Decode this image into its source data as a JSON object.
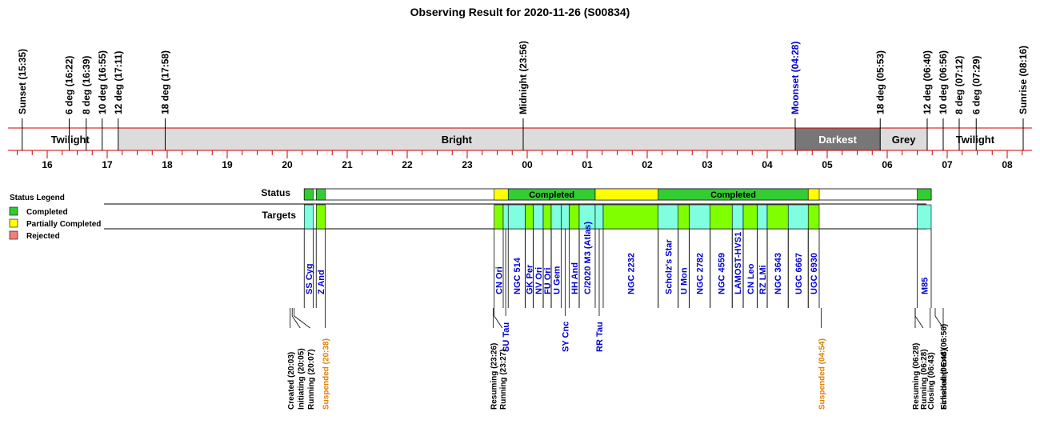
{
  "title": "Observing Result for 2020-11-26 (S00834)",
  "colors": {
    "axis": "#cc0000",
    "bright": "#dcdcdc",
    "darkest": "#777777",
    "grey": "#dcdcdc",
    "completed": "#33cc33",
    "partial": "#ffff00",
    "rejected": "#f08080",
    "target_green": "#80ff00",
    "target_cyan": "#80ffe0",
    "target_text": "#0000cc",
    "event_text": "#000000",
    "suspended": "#e08000"
  },
  "time_ticks": [
    {
      "time": "16:00",
      "label": "16"
    },
    {
      "time": "17:00",
      "label": "17"
    },
    {
      "time": "18:00",
      "label": "18"
    },
    {
      "time": "19:00",
      "label": "19"
    },
    {
      "time": "20:00",
      "label": "20"
    },
    {
      "time": "21:00",
      "label": "21"
    },
    {
      "time": "22:00",
      "label": "22"
    },
    {
      "time": "23:00",
      "label": "23"
    },
    {
      "time": "24:00",
      "label": "00"
    },
    {
      "time": "25:00",
      "label": "01"
    },
    {
      "time": "26:00",
      "label": "02"
    },
    {
      "time": "27:00",
      "label": "03"
    },
    {
      "time": "28:00",
      "label": "04"
    },
    {
      "time": "29:00",
      "label": "05"
    },
    {
      "time": "30:00",
      "label": "06"
    },
    {
      "time": "31:00",
      "label": "07"
    },
    {
      "time": "32:00",
      "label": "08"
    }
  ],
  "sky_events": [
    {
      "label": "Sunset (15:35)",
      "time": "15:35",
      "color": "#000000"
    },
    {
      "label": "6 deg (16:22)",
      "time": "16:22",
      "color": "#000000"
    },
    {
      "label": "8 deg (16:39)",
      "time": "16:39",
      "color": "#000000"
    },
    {
      "label": "10 deg (16:55)",
      "time": "16:55",
      "color": "#000000"
    },
    {
      "label": "12 deg (17:11)",
      "time": "17:11",
      "color": "#000000"
    },
    {
      "label": "18 deg (17:58)",
      "time": "17:58",
      "color": "#000000"
    },
    {
      "label": "Midnight (23:56)",
      "time": "23:56",
      "color": "#000000"
    },
    {
      "label": "Moonset (04:28)",
      "time": "28:28",
      "color": "#0000cc"
    },
    {
      "label": "18 deg (05:53)",
      "time": "29:53",
      "color": "#000000"
    },
    {
      "label": "12 deg (06:40)",
      "time": "30:40",
      "color": "#000000"
    },
    {
      "label": "10 deg (06:56)",
      "time": "30:56",
      "color": "#000000"
    },
    {
      "label": "8 deg (07:12)",
      "time": "31:12",
      "color": "#000000"
    },
    {
      "label": "6 deg (07:29)",
      "time": "31:29",
      "color": "#000000"
    },
    {
      "label": "Sunrise (08:16)",
      "time": "32:16",
      "color": "#000000"
    }
  ],
  "sky_bands": [
    {
      "label": "Twilight",
      "start": "15:35",
      "end": "17:11",
      "fill": "#ffffff",
      "text": "#000000"
    },
    {
      "label": "Bright",
      "start": "17:11",
      "end": "28:28",
      "fill": "#dcdcdc",
      "text": "#000000"
    },
    {
      "label": "Darkest",
      "start": "28:28",
      "end": "29:53",
      "fill": "#777777",
      "text": "#ffffff"
    },
    {
      "label": "Grey",
      "start": "29:53",
      "end": "30:40",
      "fill": "#dcdcdc",
      "text": "#000000"
    },
    {
      "label": "Twilight",
      "start": "30:40",
      "end": "32:16",
      "fill": "#ffffff",
      "text": "#000000"
    }
  ],
  "legend": {
    "title": "Status Legend",
    "items": [
      {
        "label": "Completed",
        "color": "#33cc33"
      },
      {
        "label": "Partially Completed",
        "color": "#ffff00"
      },
      {
        "label": "Rejected",
        "color": "#f08080"
      }
    ]
  },
  "row_labels": {
    "status": "Status",
    "targets": "Targets"
  },
  "status_segments": [
    {
      "start": "20:17",
      "end": "20:26",
      "status": "completed",
      "label": ""
    },
    {
      "start": "20:29",
      "end": "20:38",
      "status": "completed",
      "label": ""
    },
    {
      "start": "23:27",
      "end": "23:41",
      "status": "partial",
      "label": ""
    },
    {
      "start": "23:41",
      "end": "25:08",
      "status": "completed",
      "label": "Completed"
    },
    {
      "start": "25:08",
      "end": "26:11",
      "status": "partial",
      "label": ""
    },
    {
      "start": "26:11",
      "end": "28:41",
      "status": "completed",
      "label": "Completed"
    },
    {
      "start": "28:41",
      "end": "28:52",
      "status": "partial",
      "label": ""
    },
    {
      "start": "30:30",
      "end": "30:44",
      "status": "completed",
      "label": ""
    }
  ],
  "targets": [
    {
      "name": "SS Cyg",
      "start": "20:17",
      "end": "20:26",
      "color": "cyan",
      "label_pos": "upper"
    },
    {
      "name": "Z And",
      "start": "20:29",
      "end": "20:38",
      "color": "green",
      "label_pos": "upper"
    },
    {
      "name": "CN Ori",
      "start": "23:27",
      "end": "23:36",
      "color": "green",
      "label_pos": "upper"
    },
    {
      "name": "SU Tau",
      "start": "23:36",
      "end": "23:41",
      "color": "cyan",
      "label_pos": "lower"
    },
    {
      "name": "NGC 514",
      "start": "23:41",
      "end": "23:58",
      "color": "cyan",
      "label_pos": "upper"
    },
    {
      "name": "GK Per",
      "start": "23:58",
      "end": "24:06",
      "color": "green",
      "label_pos": "upper"
    },
    {
      "name": "NV Ori",
      "start": "24:06",
      "end": "24:16",
      "color": "cyan",
      "label_pos": "upper"
    },
    {
      "name": "FU Ori",
      "start": "24:16",
      "end": "24:24",
      "color": "green",
      "label_pos": "upper"
    },
    {
      "name": "U Gem",
      "start": "24:24",
      "end": "24:34",
      "color": "cyan",
      "label_pos": "upper"
    },
    {
      "name": "SY Cnc",
      "start": "24:34",
      "end": "24:42",
      "color": "cyan",
      "label_pos": "lower"
    },
    {
      "name": "HH And",
      "start": "24:42",
      "end": "24:52",
      "color": "green",
      "label_pos": "upper"
    },
    {
      "name": "C/2020 M3 (Atlas)",
      "start": "24:52",
      "end": "25:08",
      "color": "cyan",
      "label_pos": "upper"
    },
    {
      "name": "RR Tau",
      "start": "25:08",
      "end": "25:16",
      "color": "cyan",
      "label_pos": "lower"
    },
    {
      "name": "NGC 2232",
      "start": "25:16",
      "end": "26:11",
      "color": "green",
      "label_pos": "upper"
    },
    {
      "name": "Scholz's Star",
      "start": "26:11",
      "end": "26:31",
      "color": "cyan",
      "label_pos": "upper"
    },
    {
      "name": "U Mon",
      "start": "26:31",
      "end": "26:42",
      "color": "green",
      "label_pos": "upper"
    },
    {
      "name": "NGC 2782",
      "start": "26:42",
      "end": "27:03",
      "color": "cyan",
      "label_pos": "upper"
    },
    {
      "name": "NGC 4559",
      "start": "27:03",
      "end": "27:25",
      "color": "green",
      "label_pos": "upper"
    },
    {
      "name": "LAMOST-HVS1",
      "start": "27:25",
      "end": "27:36",
      "color": "cyan",
      "label_pos": "upper"
    },
    {
      "name": "CN Leo",
      "start": "27:36",
      "end": "27:50",
      "color": "green",
      "label_pos": "upper"
    },
    {
      "name": "RZ LMi",
      "start": "27:50",
      "end": "28:00",
      "color": "cyan",
      "label_pos": "upper"
    },
    {
      "name": "NGC 3643",
      "start": "28:00",
      "end": "28:21",
      "color": "green",
      "label_pos": "upper"
    },
    {
      "name": "UGC 6667",
      "start": "28:21",
      "end": "28:41",
      "color": "cyan",
      "label_pos": "upper"
    },
    {
      "name": "UGC 6930",
      "start": "28:41",
      "end": "28:52",
      "color": "green",
      "label_pos": "upper"
    },
    {
      "name": "M85",
      "start": "30:30",
      "end": "30:44",
      "color": "cyan",
      "label_pos": "upper"
    }
  ],
  "system_events": [
    {
      "label": "Created (20:03)",
      "time": "20:03",
      "kind": "normal"
    },
    {
      "label": "Initiating (20:05)",
      "time": "20:05",
      "kind": "normal"
    },
    {
      "label": "Running (20:07)",
      "time": "20:07",
      "kind": "normal"
    },
    {
      "label": "Suspended (20:38)",
      "time": "20:38",
      "kind": "suspended"
    },
    {
      "label": "Resuming (23:26)",
      "time": "23:26",
      "kind": "normal"
    },
    {
      "label": "Running (23:27)",
      "time": "23:27",
      "kind": "normal"
    },
    {
      "label": "Suspended (04:54)",
      "time": "28:54",
      "kind": "suspended"
    },
    {
      "label": "Resuming (06:28)",
      "time": "30:28",
      "kind": "normal"
    },
    {
      "label": "Running (06:28)",
      "time": "30:28",
      "kind": "normal"
    },
    {
      "label": "Closing (06:43)",
      "time": "30:43",
      "kind": "normal"
    },
    {
      "label": "Finished (06:48)",
      "time": "30:48",
      "kind": "normal"
    },
    {
      "label": "Scheduled End (06:56)",
      "time": "30:56",
      "kind": "normal"
    }
  ]
}
